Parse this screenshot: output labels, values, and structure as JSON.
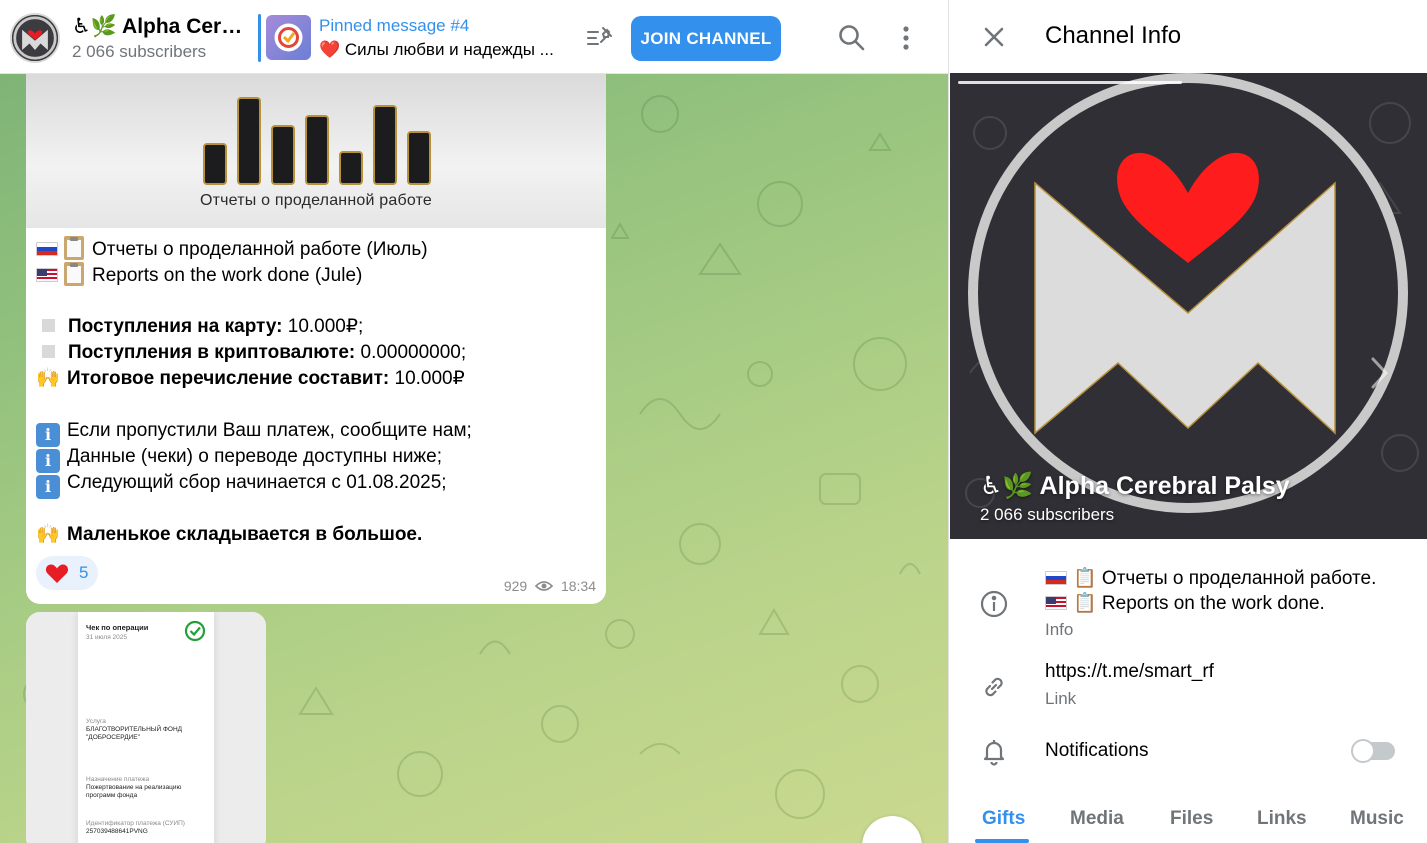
{
  "header": {
    "channel_title": "♿🌿 Alpha Cerebral Palsy",
    "subscribers": "2 066 subscribers",
    "pinned_title": "Pinned message #4",
    "pinned_text": "❤️ Силы любви и надежды ...",
    "join_label": "JOIN CHANNEL"
  },
  "message1": {
    "image_caption": "Отчеты о проделанной работе",
    "title_ru": "Отчеты о проделанной работе (Июль)",
    "title_en": "Reports on the work done (Jule)",
    "card_label": "Поступления на карту:",
    "card_value": " 10.000₽;",
    "crypto_label": "Поступления в криптовалюте:",
    "crypto_value": " 0.00000000;",
    "total_label": "Итоговое перечисление составит:",
    "total_value": " 10.000₽",
    "note1": "Если пропустили Ваш платеж, сообщите нам;",
    "note2": "Данные (чеки) о переводе доступны ниже;",
    "note3": "Следующий сбор начинается с 01.08.2025;",
    "closing": "Маленькое складывается в большое.",
    "reaction_count": "5",
    "views": "929",
    "time": "18:34"
  },
  "message2": {
    "receipt_title": "Чек по операции",
    "receipt_date": "31 июля 2025",
    "service_label": "Услуга",
    "service_value_1": "БЛАГОТВОРИТЕЛЬНЫЙ ФОНД",
    "service_value_2": "\"ДОБРОСЕРДИЕ\"",
    "purpose_label": "Назначение платежа",
    "purpose_value_1": "Пожертвование на реализацию",
    "purpose_value_2": "программ фонда",
    "id_label": "Идентификатор платежа (СУИП)",
    "id_value": "257039488641PVNG"
  },
  "panel": {
    "title": "Channel Info",
    "cover_name": "♿🌿 Alpha Cerebral Palsy",
    "cover_subs": "2 066 subscribers",
    "info_line1": "📋 Отчеты о проделанной работе.",
    "info_line2": "📋 Reports on the work done.",
    "info_label": "Info",
    "link_value": "https://t.me/smart_rf",
    "link_label": "Link",
    "notifications_label": "Notifications",
    "notifications_on": false
  },
  "tabs": [
    {
      "label": "Gifts",
      "active": true
    },
    {
      "label": "Media",
      "active": false
    },
    {
      "label": "Files",
      "active": false
    },
    {
      "label": "Links",
      "active": false
    },
    {
      "label": "Music",
      "active": false
    }
  ],
  "colors": {
    "accent": "#3390ec",
    "muted": "#707579",
    "chat_bg_start": "#7fb477",
    "chat_bg_end": "#cad98f",
    "heart": "#e81c24"
  }
}
